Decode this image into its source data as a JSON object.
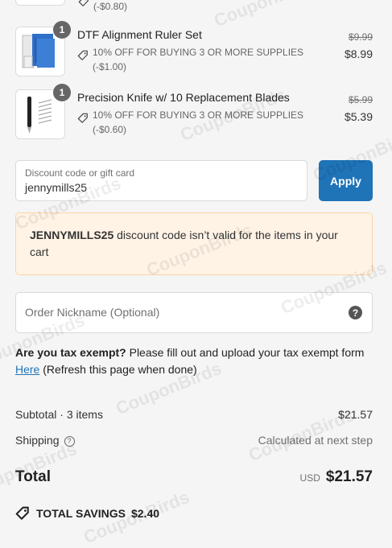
{
  "top_partial": {
    "discount_amount": "(-$0.80)"
  },
  "items": [
    {
      "name": "DTF Alignment Ruler Set",
      "quantity": "1",
      "discount_text": "10% OFF FOR BUYING 3 OR MORE SUPPLIES",
      "discount_amount": "(-$1.00)",
      "original_price": "$9.99",
      "final_price": "$8.99",
      "image": "ruler-set-image"
    },
    {
      "name": "Precision Knife w/ 10 Replacement Blades",
      "quantity": "1",
      "discount_text": "10% OFF FOR BUYING 3 OR MORE SUPPLIES",
      "discount_amount": "(-$0.60)",
      "original_price": "$5.99",
      "final_price": "$5.39",
      "image": "precision-knife-image"
    }
  ],
  "discount": {
    "label": "Discount code or gift card",
    "value": "jennymills25",
    "apply_label": "Apply"
  },
  "alert": {
    "code": "JENNYMILLS25",
    "message": " discount code isn’t valid for the items in your cart"
  },
  "nickname": {
    "placeholder": "Order Nickname (Optional)",
    "help_icon": "question-circle-icon"
  },
  "tax": {
    "question": "Are you tax exempt?",
    "text": " Please fill out and upload your tax exempt form ",
    "link": "Here",
    "after": " (Refresh this page when done)"
  },
  "summary": {
    "subtotal_label": "Subtotal · 3 items",
    "subtotal_value": "$21.57",
    "shipping_label": "Shipping",
    "shipping_value": "Calculated at next step",
    "total_label": "Total",
    "total_currency": "USD",
    "total_value": "$21.57",
    "savings_label": "TOTAL SAVINGS",
    "savings_value": "$2.40"
  },
  "watermark": "CouponBirds",
  "colors": {
    "accent": "#1f73b7",
    "alert_bg": "#fff3e6",
    "alert_border": "#fbd5a4"
  }
}
